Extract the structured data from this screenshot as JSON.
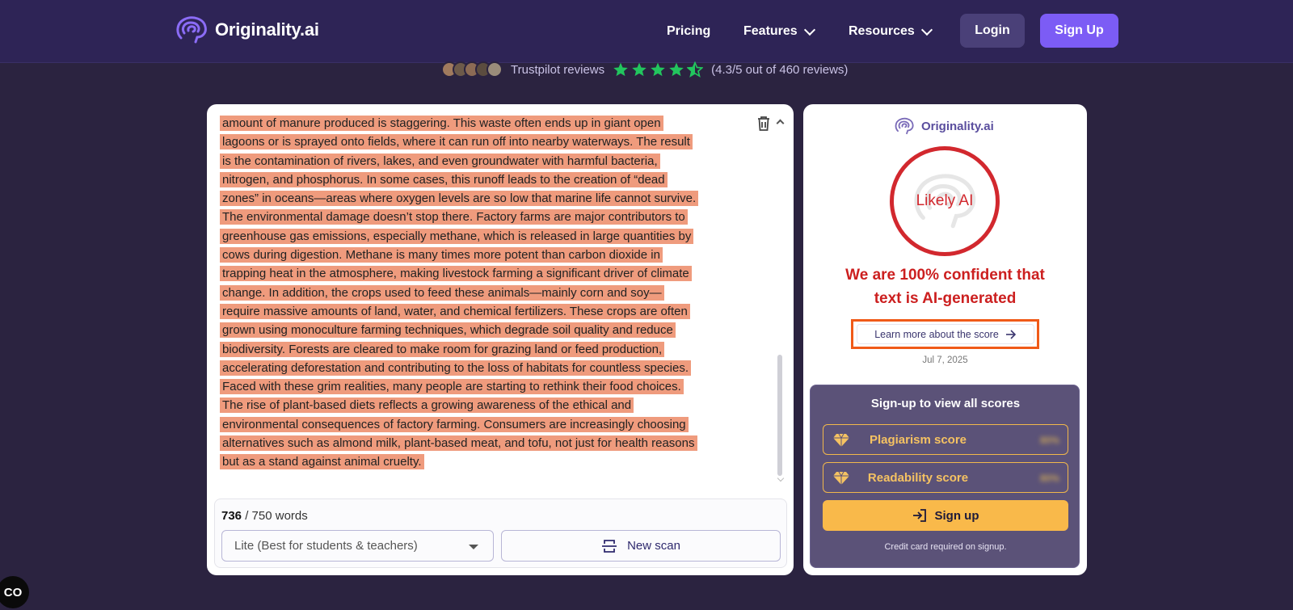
{
  "header": {
    "brand": "Originality.ai",
    "nav": {
      "pricing": "Pricing",
      "features": "Features",
      "resources": "Resources"
    },
    "login": "Login",
    "signup": "Sign Up"
  },
  "trust": {
    "label": "Trustpilot reviews",
    "rating_text": "(4.3/5 out of 460 reviews)",
    "rating": 4.3,
    "star_color": "#22c55e"
  },
  "editor": {
    "lines": [
      "amount of manure produced is staggering. This waste often ends up in giant open",
      "lagoons or is sprayed onto fields, where it can run off into nearby waterways. The result",
      "is the contamination of rivers, lakes, and even groundwater with harmful bacteria,",
      "nitrogen, and phosphorus. In some cases, this runoff leads to the creation of “dead",
      "zones” in oceans—areas where oxygen levels are so low that marine life cannot survive.",
      "The environmental damage doesn’t stop there. Factory farms are major contributors to",
      "greenhouse gas emissions, especially methane, which is released in large quantities by",
      "cows during digestion. Methane is many times more potent than carbon dioxide in",
      "trapping heat in the atmosphere, making livestock farming a significant driver of climate",
      "change. In addition, the crops used to feed these animals—mainly corn and soy—",
      "require massive amounts of land, water, and chemical fertilizers. These crops are often",
      "grown using monoculture farming techniques, which degrade soil quality and reduce",
      "biodiversity. Forests are cleared to make room for grazing land or feed production,",
      "accelerating deforestation and contributing to the loss of habitats for countless species.",
      "Faced with these grim realities, many people are starting to rethink their food choices.",
      "The rise of plant-based diets reflects a growing awareness of the ethical and",
      "environmental consequences of factory farming. Consumers are increasingly choosing",
      "alternatives such as almond milk, plant-based meat, and tofu, not just for health reasons",
      "but as a stand against animal cruelty."
    ],
    "highlight_color": "#ef9b7d",
    "word_count": "736",
    "word_limit": "/ 750 words",
    "model_select": "Lite (Best for students & teachers)",
    "new_scan": "New scan"
  },
  "result": {
    "brand": "Originality.ai",
    "verdict": "Likely AI",
    "confidence_line1": "We are 100% confident that",
    "confidence_line2": "text is AI-generated",
    "learn_more": "Learn more about the score",
    "date": "Jul 7, 2025",
    "accent_color": "#d2282e"
  },
  "signup_box": {
    "title": "Sign-up to view all scores",
    "plagiarism": "Plagiarism score",
    "readability": "Readability score",
    "blurred_value": "80%",
    "signup": "Sign up",
    "credit_note": "Credit card required on signup."
  },
  "badge": {
    "label": "CO"
  }
}
